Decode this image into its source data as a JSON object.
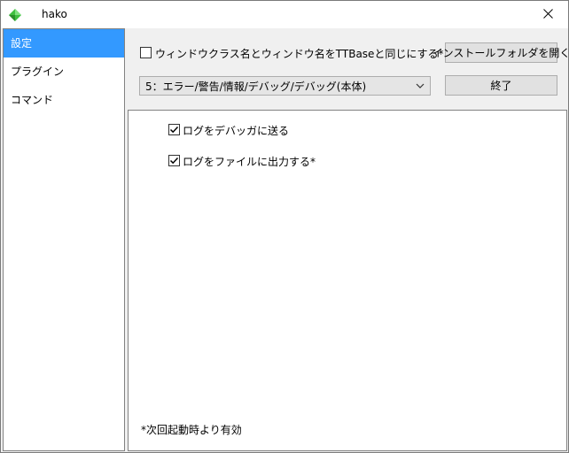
{
  "window": {
    "title": "hako",
    "icon": "green-diamond-icon",
    "close_icon": "close-icon"
  },
  "sidebar": {
    "items": [
      {
        "label": "設定",
        "selected": true
      },
      {
        "label": "プラグイン",
        "selected": false
      },
      {
        "label": "コマンド",
        "selected": false
      }
    ]
  },
  "top": {
    "same_class_checkbox": {
      "label": "ウィンドウクラス名とウィンドウ名をTTBaseと同じにする*",
      "checked": false
    },
    "log_level_select": {
      "value": "5：エラー/警告/情報/デバッグ/デバッグ(本体)"
    },
    "open_folder_button": "インストールフォルダを開く",
    "exit_button": "終了"
  },
  "panel": {
    "send_to_debugger": {
      "label": "ログをデバッガに送る",
      "checked": true
    },
    "output_to_file": {
      "label": "ログをファイルに出力する*",
      "checked": true
    },
    "note": "*次回起動時より有効"
  },
  "colors": {
    "accent": "#3399ff",
    "icon_green": "#3fbf3f"
  }
}
